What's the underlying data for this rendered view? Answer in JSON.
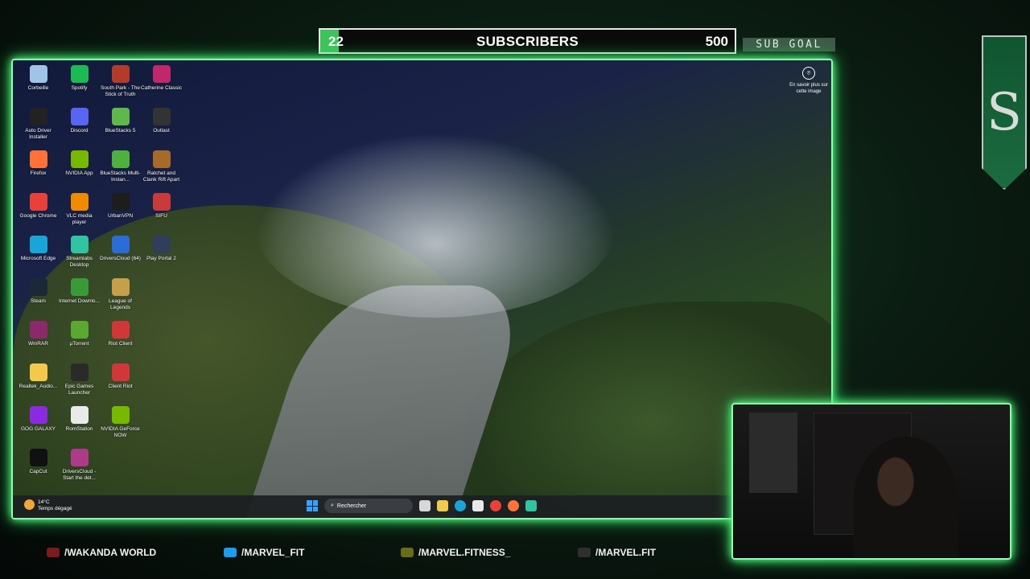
{
  "goal": {
    "current": "22",
    "title": "SUBSCRIBERS",
    "target": "500",
    "progress_fraction": 0.044,
    "tag": "SUB GOAL"
  },
  "desktop": {
    "icons": [
      {
        "label": "Corbeille",
        "icon": "recycle-bin-icon",
        "color": "#9fc4e8"
      },
      {
        "label": "Spotify",
        "icon": "spotify-icon",
        "color": "#1db954"
      },
      {
        "label": "South Park - The Stick of Truth",
        "icon": "game-icon",
        "color": "#b33b2b"
      },
      {
        "label": "Catherine Classic",
        "icon": "game-icon",
        "color": "#c0286b"
      },
      {
        "label": "Auto Driver Installer",
        "icon": "driver-icon",
        "color": "#222"
      },
      {
        "label": "Discord",
        "icon": "discord-icon",
        "color": "#5865f2"
      },
      {
        "label": "BlueStacks 5",
        "icon": "bluestacks-icon",
        "color": "#5fb84b"
      },
      {
        "label": "Outlast",
        "icon": "game-icon",
        "color": "#333"
      },
      {
        "label": "Firefox",
        "icon": "firefox-icon",
        "color": "#ff7139"
      },
      {
        "label": "NVIDIA App",
        "icon": "nvidia-icon",
        "color": "#76b900"
      },
      {
        "label": "BlueStacks Multi-Instan...",
        "icon": "bluestacks-icon",
        "color": "#4fb040"
      },
      {
        "label": "Ratchet and Clank Rift Apart",
        "icon": "game-icon",
        "color": "#a66a2a"
      },
      {
        "label": "Google Chrome",
        "icon": "chrome-icon",
        "color": "#e9413a"
      },
      {
        "label": "VLC media player",
        "icon": "vlc-icon",
        "color": "#f08a00"
      },
      {
        "label": "UrbanVPN",
        "icon": "vpn-icon",
        "color": "#1d1d1d"
      },
      {
        "label": "SIFU",
        "icon": "game-icon",
        "color": "#c93a3a"
      },
      {
        "label": "Microsoft Edge",
        "icon": "edge-icon",
        "color": "#1aa5d8"
      },
      {
        "label": "Streamlabs Desktop",
        "icon": "streamlabs-icon",
        "color": "#31c3a2"
      },
      {
        "label": "DriversCloud (64)",
        "icon": "driverscloud-icon",
        "color": "#2c6cd6"
      },
      {
        "label": "Play Portal 2",
        "icon": "game-icon",
        "color": "#2f3e5a"
      },
      {
        "label": "Steam",
        "icon": "steam-icon",
        "color": "#1b2838"
      },
      {
        "label": "Internet Downlo...",
        "icon": "download-icon",
        "color": "#3a9a3a"
      },
      {
        "label": "League of Legends",
        "icon": "lol-icon",
        "color": "#c4a04a"
      },
      {
        "label": "",
        "icon": "",
        "color": "transparent"
      },
      {
        "label": "WinRAR",
        "icon": "winrar-icon",
        "color": "#8b2a6b"
      },
      {
        "label": "µTorrent",
        "icon": "utorrent-icon",
        "color": "#5aa832"
      },
      {
        "label": "Riot Client",
        "icon": "riot-icon",
        "color": "#d13639"
      },
      {
        "label": "",
        "icon": "",
        "color": "transparent"
      },
      {
        "label": "Realtek_Audio...",
        "icon": "folder-icon",
        "color": "#f2c94c"
      },
      {
        "label": "Epic Games Launcher",
        "icon": "epic-icon",
        "color": "#2a2a2a"
      },
      {
        "label": "Client Riot",
        "icon": "riot-icon",
        "color": "#d13639"
      },
      {
        "label": "",
        "icon": "",
        "color": "transparent"
      },
      {
        "label": "GOG GALAXY",
        "icon": "gog-icon",
        "color": "#8a2be2"
      },
      {
        "label": "RomStation",
        "icon": "romstation-icon",
        "color": "#eaeaea"
      },
      {
        "label": "NVIDIA GeForce NOW",
        "icon": "nvidia-icon",
        "color": "#76b900"
      },
      {
        "label": "",
        "icon": "",
        "color": "transparent"
      },
      {
        "label": "CapCut",
        "icon": "capcut-icon",
        "color": "#111"
      },
      {
        "label": "DriversCloud - Start the det...",
        "icon": "driverscloud-icon",
        "color": "#b03a8a"
      }
    ],
    "learn_more": "En savoir plus sur cette image"
  },
  "taskbar": {
    "temperature": "14°C",
    "weather": "Temps dégagé",
    "search_placeholder": "Rechercher"
  },
  "logo_letter": "S",
  "social": [
    {
      "handle": "/WAKANDA WORLD",
      "icon": "youtube-icon",
      "color": "#7a1c1c"
    },
    {
      "handle": "/MARVEL_FIT",
      "icon": "twitter-icon",
      "color": "#1d9bf0"
    },
    {
      "handle": "/MARVEL.FITNESS_",
      "icon": "snapchat-icon",
      "color": "#6b6b1a"
    },
    {
      "handle": "/MARVEL.FIT",
      "icon": "tiktok-icon",
      "color": "#2f2f2f"
    }
  ]
}
